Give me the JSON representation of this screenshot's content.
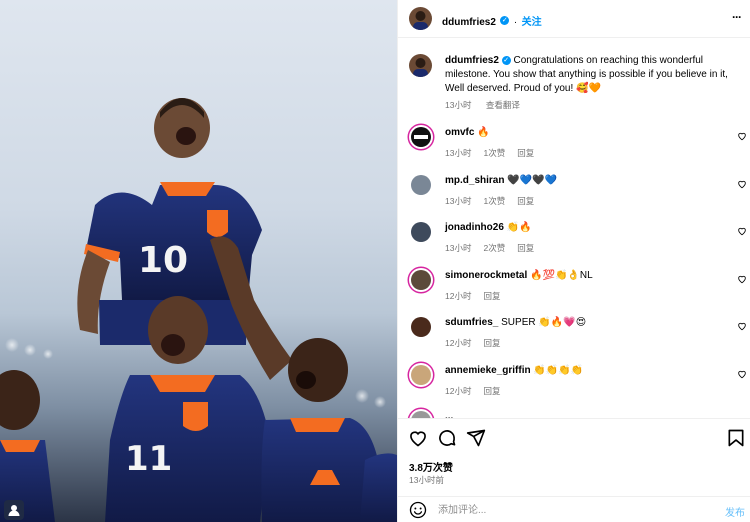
{
  "post": {
    "author": "ddumfries2",
    "follow_label": "关注",
    "more_label": "···",
    "caption": {
      "username": "ddumfries2",
      "text": "Congratulations on reaching this wonderful milestone. You show that anything is possible if you believe in it, Well deserved. Proud of you! 🥰🧡",
      "time": "13小时",
      "translate": "查看翻译"
    },
    "comments": [
      {
        "username": "omvfc",
        "text": "🔥",
        "time": "13小时",
        "likes": "1次赞",
        "reply": "回复"
      },
      {
        "username": "mp.d_shiran",
        "text": "🖤💙🖤💙",
        "time": "13小时",
        "likes": "1次赞",
        "reply": "回复"
      },
      {
        "username": "jonadinho26",
        "text": "👏🔥",
        "time": "13小时",
        "likes": "2次赞",
        "reply": "回复"
      },
      {
        "username": "simonerockmetal",
        "text": "🔥💯👏👌NL",
        "time": "12小时",
        "likes": "",
        "reply": "回复"
      },
      {
        "username": "sdumfries_",
        "text": "SUPER 👏🔥💗😍",
        "time": "12小时",
        "likes": "",
        "reply": "回复"
      },
      {
        "username": "annemieke_griffin",
        "text": "👏👏👏👏",
        "time": "12小时",
        "likes": "",
        "reply": "回复"
      },
      {
        "username": "...",
        "text": "",
        "time": "",
        "likes": "",
        "reply": ""
      }
    ],
    "like_count": "3.8万次赞",
    "post_time": "13小时前",
    "comment_placeholder": "添加评论...",
    "post_button": "发布"
  },
  "photo": {
    "jersey_numbers": [
      "10",
      "11"
    ]
  },
  "colors": {
    "accent": "#0095f6",
    "kit_blue": "#1b2a6b",
    "kit_orange": "#f36c21"
  },
  "icons": [
    "verified-icon",
    "more-icon",
    "heart-icon",
    "comment-icon",
    "share-icon",
    "bookmark-icon",
    "emoji-icon",
    "user-icon"
  ]
}
